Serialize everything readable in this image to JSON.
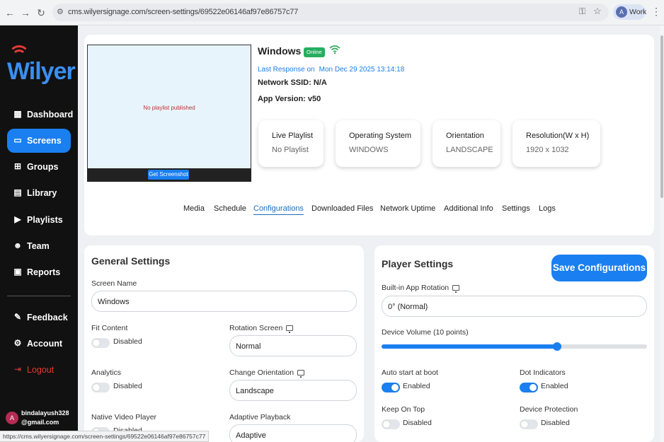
{
  "browser": {
    "url": "cms.wilyersignage.com/screen-settings/69522e06146af97e86757c77",
    "profile_initial": "A",
    "profile_label": "Work",
    "status_url": "https://cms.wilyersignage.com/screen-settings/69522e06146af97e86757c77"
  },
  "sidebar": {
    "logo": "Wilyer",
    "items": [
      {
        "label": "Dashboard",
        "icon": "dashboard-icon"
      },
      {
        "label": "Screens",
        "icon": "screen-icon",
        "active": true
      },
      {
        "label": "Groups",
        "icon": "groups-icon"
      },
      {
        "label": "Library",
        "icon": "library-icon"
      },
      {
        "label": "Playlists",
        "icon": "playlist-icon"
      },
      {
        "label": "Team",
        "icon": "team-icon"
      },
      {
        "label": "Reports",
        "icon": "reports-icon"
      }
    ],
    "bottom_items": [
      {
        "label": "Feedback",
        "icon": "feedback-icon"
      },
      {
        "label": "Account",
        "icon": "gear-icon"
      },
      {
        "label": "Logout",
        "icon": "logout-icon"
      }
    ],
    "user_initial": "A",
    "user_email": "bindalayush328@gmail.com"
  },
  "device": {
    "preview_message": "No playlist published",
    "screenshot_button": "Get Screenshot",
    "name": "Windows",
    "status": "Online",
    "last_response_label": "Last Response on",
    "last_response_value": "Mon Dec 29 2025 13:14:18",
    "network_ssid": "Network SSID: N/A",
    "app_version": "App Version: v50",
    "stats": [
      {
        "title": "Live Playlist",
        "value": "No Playlist"
      },
      {
        "title": "Operating System",
        "value": "WINDOWS"
      },
      {
        "title": "Orientation",
        "value": "LANDSCAPE"
      },
      {
        "title": "Resolution(W x H)",
        "value": "1920 x 1032"
      }
    ],
    "tabs": [
      "Media",
      "Schedule",
      "Configurations",
      "Downloaded Files",
      "Network Uptime",
      "Additional Info",
      "Settings",
      "Logs"
    ],
    "active_tab": "Configurations"
  },
  "general": {
    "title": "General Settings",
    "screen_name_label": "Screen Name",
    "screen_name_value": "Windows",
    "fit_content_label": "Fit Content",
    "fit_content_state": "Disabled",
    "rotation_screen_label": "Rotation Screen",
    "rotation_screen_value": "Normal",
    "analytics_label": "Analytics",
    "analytics_state": "Disabled",
    "change_orientation_label": "Change Orientation",
    "change_orientation_value": "Landscape",
    "native_video_label": "Native Video Player",
    "native_video_state": "Disabled",
    "adaptive_playback_label": "Adaptive Playback",
    "adaptive_playback_value": "Adaptive"
  },
  "player": {
    "title": "Player Settings",
    "save_button": "Save Configurations",
    "rotation_label": "Built-in App Rotation",
    "rotation_value": "0° (Normal)",
    "volume_label": "Device Volume (10 points)",
    "volume_fraction": 0.66,
    "auto_start_label": "Auto start at boot",
    "auto_start_state": "Enabled",
    "dot_indicators_label": "Dot Indicators",
    "dot_indicators_state": "Enabled",
    "keep_on_top_label": "Keep On Top",
    "keep_on_top_state": "Disabled",
    "device_protection_label": "Device Protection",
    "device_protection_state": "Disabled"
  },
  "colors": {
    "accent": "#1a7ff0",
    "online": "#27ae60",
    "sidebar": "#111111",
    "logout": "#e53935"
  }
}
